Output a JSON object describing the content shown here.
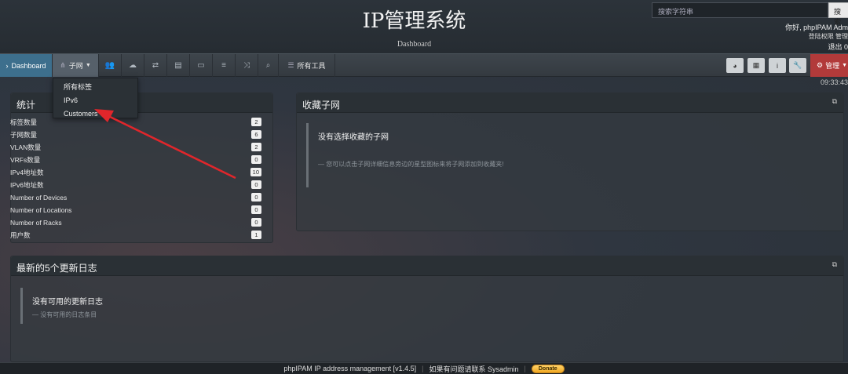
{
  "header": {
    "title": "IP管理系统",
    "subtitle": "Dashboard",
    "search_placeholder": "搜索字符串",
    "search_button": "搜索",
    "user_hello": "你好, phpIPAM Adm",
    "user_links": "登陆权限  管理",
    "logout": "退出  0"
  },
  "nav": {
    "dashboard": "Dashboard",
    "subnets": "子网",
    "tools": "所有工具",
    "admin": "管理",
    "icons": [
      "users-icon",
      "cloud-icon",
      "exchange-icon",
      "map-icon",
      "monitor-icon",
      "list-icon",
      "shuffle-icon",
      "search-icon"
    ],
    "right_icons": [
      "dashboard-icon",
      "grid-icon",
      "info-icon",
      "wrench-icon"
    ]
  },
  "clock": "09:33:43",
  "dropdown": {
    "items": [
      "所有标签",
      "IPv6",
      "Customers"
    ]
  },
  "stats": {
    "title": "统计",
    "rows": [
      {
        "label": "标签数量",
        "value": "2"
      },
      {
        "label": "子网数量",
        "value": "6"
      },
      {
        "label": "VLAN数量",
        "value": "2"
      },
      {
        "label": "VRFs数量",
        "value": "0"
      },
      {
        "label": "IPv4地址数",
        "value": "10"
      },
      {
        "label": "IPv6地址数",
        "value": "0"
      },
      {
        "label": "Number of Devices",
        "value": "0"
      },
      {
        "label": "Number of Locations",
        "value": "0"
      },
      {
        "label": "Number of Racks",
        "value": "0"
      },
      {
        "label": "用户数",
        "value": "1"
      }
    ]
  },
  "favorites": {
    "title": "收藏子网",
    "empty_title": "没有选择收藏的子网",
    "empty_hint": "— 您可以点击子网详细信息旁边的星型图标来将子网添加到收藏夹!"
  },
  "changelog": {
    "title": "最新的5个更新日志",
    "empty_title": "没有可用的更新日志",
    "empty_hint": "— 没有可用的日志条目"
  },
  "footer": {
    "version": "phpIPAM IP address management [v1.4.5]",
    "contact": "如果有问题请联系 Sysadmin",
    "donate": "Donate"
  },
  "colors": {
    "dashboard_tab": "#3d6f8d",
    "admin_button": "#b23a3a",
    "annotation_arrow": "#e0262b"
  }
}
